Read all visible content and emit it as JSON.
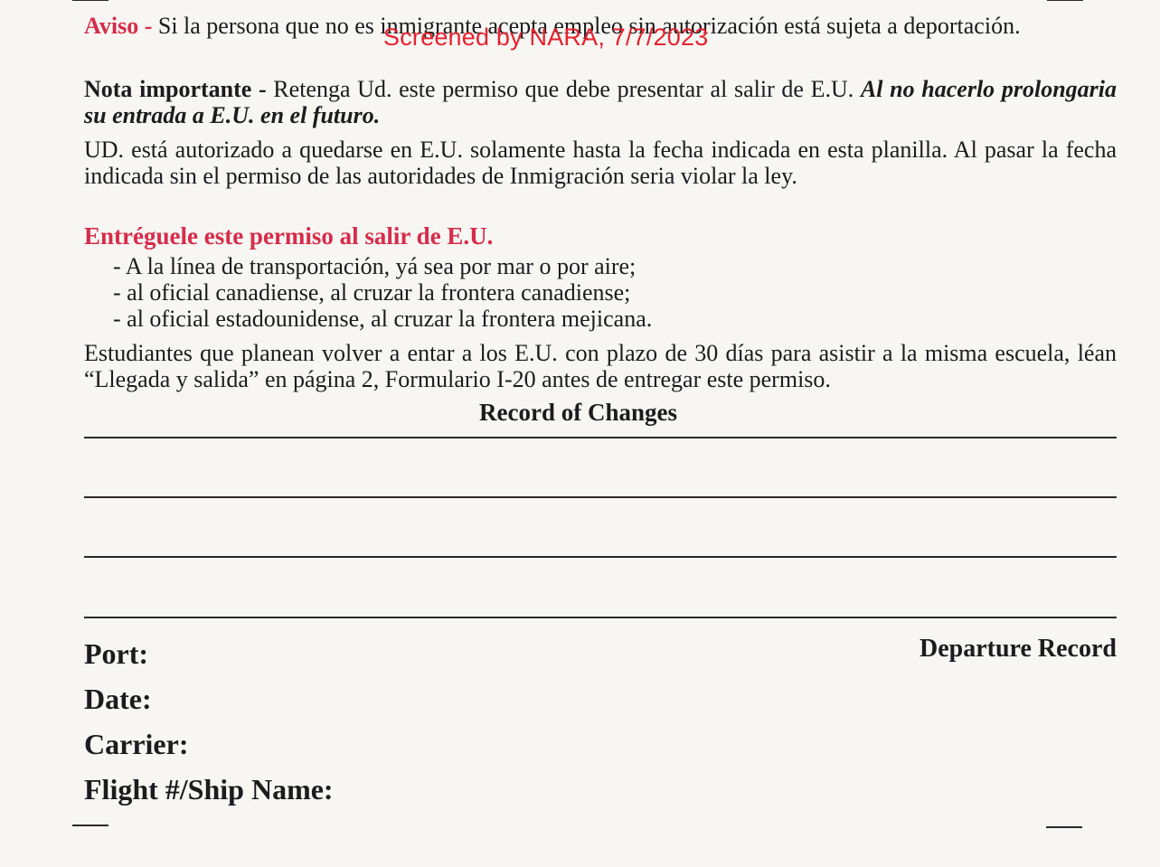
{
  "watermark": "Screened by NARA, 7/7/2023",
  "aviso": {
    "label": "Aviso -",
    "text": " Si la persona que no es inmigrante acepta empleo sin autorización está sujeta a deportación."
  },
  "nota": {
    "label": "Nota importante -",
    "text": " Retenga Ud. este permiso que debe presentar al salir de E.U. ",
    "emphasis": "Al no hacerlo prolongaria su entrada a E.U. en el futuro."
  },
  "stay_paragraph": "UD. está autorizado a quedarse en E.U. solamente hasta la fecha indicada en esta planilla. Al pasar la fecha indicada sin el permiso de las autoridades de Inmigración seria violar la ley.",
  "surrender_heading": "Entréguele este permiso al salir de E.U.",
  "surrender_items": [
    "- A la línea de transportación, yá sea por mar o por aire;",
    "- al oficial canadiense, al cruzar la frontera canadiense;",
    "- al oficial estadounidense, al cruzar la frontera mejicana."
  ],
  "students_paragraph": "Estudiantes que planean volver a entar a los E.U. con plazo de 30 días para asistir a la misma escuela, léan “Llegada y salida” en página 2, Formulario I-20 antes de entregar este permiso.",
  "record_of_changes": "Record of Changes",
  "departure_record": "Departure Record",
  "fields": {
    "port": "Port:",
    "date": "Date:",
    "carrier": "Carrier:",
    "flight": "Flight #/Ship Name:"
  }
}
